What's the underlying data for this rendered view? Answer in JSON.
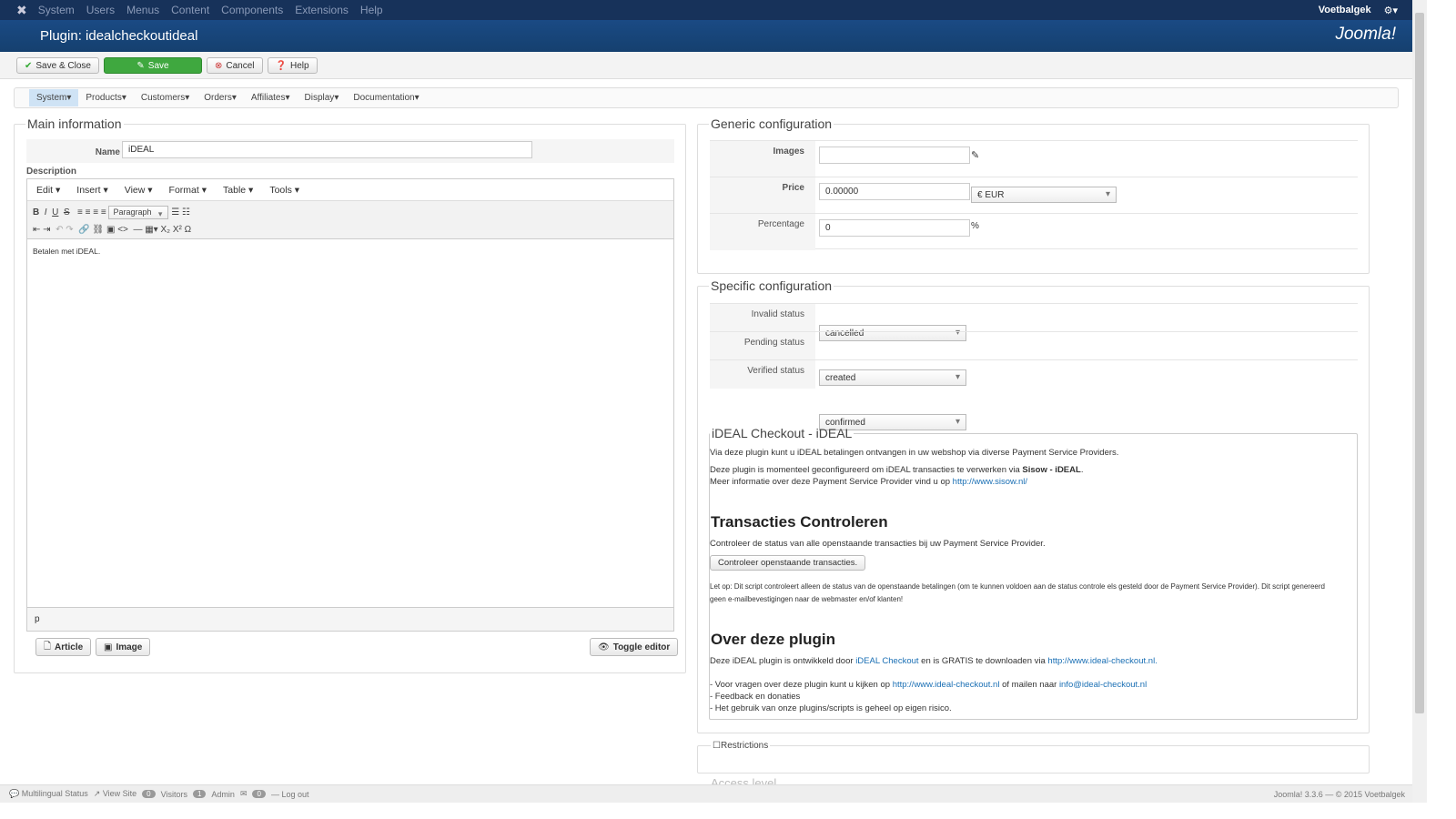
{
  "topnav": {
    "menus": [
      "System",
      "Users",
      "Menus",
      "Content",
      "Components",
      "Extensions",
      "Help"
    ],
    "user": "Voetbalgek"
  },
  "header": {
    "title": "Plugin: idealcheckoutideal",
    "brand": "Joomla!"
  },
  "toolbar": {
    "save_close": "Save & Close",
    "save": "Save",
    "cancel": "Cancel",
    "help": "Help"
  },
  "submenu": [
    "System",
    "Products",
    "Customers",
    "Orders",
    "Affiliates",
    "Display",
    "Documentation"
  ],
  "main": {
    "legend": "Main information",
    "name_label": "Name",
    "name_value": "iDEAL",
    "description_label": "Description",
    "editor_menu": [
      "Edit",
      "Insert",
      "View",
      "Format",
      "Table",
      "Tools"
    ],
    "format_select": "Paragraph",
    "content": "Betalen met iDEAL.",
    "path": "p",
    "article": "Article",
    "image": "Image",
    "toggle": "Toggle editor"
  },
  "generic": {
    "legend": "Generic configuration",
    "images_label": "Images",
    "price_label": "Price",
    "price_value": "0.00000",
    "currency": "€ EUR",
    "percentage_label": "Percentage",
    "percentage_value": "0",
    "percent_sign": "%"
  },
  "specific": {
    "legend": "Specific configuration",
    "rows": [
      {
        "label": "Invalid status",
        "value": "cancelled"
      },
      {
        "label": "Pending status",
        "value": "created"
      },
      {
        "label": "Verified status",
        "value": "confirmed"
      }
    ]
  },
  "ideal": {
    "legend": "iDEAL Checkout - iDEAL",
    "p1": "Via deze plugin kunt u iDEAL betalingen ontvangen in uw webshop via diverse Payment Service Providers.",
    "p2a": "Deze plugin is momenteel geconfigureerd om iDEAL transacties te verwerken via ",
    "p2b": "Sisow - iDEAL",
    "p3a": "Meer informatie over deze Payment Service Provider vind u op ",
    "p3link": "http://www.sisow.nl/",
    "h_trans": "Transacties Controleren",
    "p4": "Controleer de status van alle openstaande transacties bij uw Payment Service Provider.",
    "check_button": "Controleer openstaande transacties.",
    "note1": "Let op: Dit script controleert alleen de status van de openstaande betalingen (om te kunnen voldoen aan de status controle els gesteld door de Payment Service Provider). Dit script genereerd",
    "note2": "geen e-mailbevestigingen naar de webmaster en/of klanten!",
    "h_over": "Over deze plugin",
    "o1a": "Deze iDEAL plugin is ontwikkeld door ",
    "o1link": "iDEAL Checkout",
    "o1b": " en is GRATIS te downloaden via ",
    "o1url": "http://www.ideal-checkout.nl.",
    "o2a": "- Voor vragen over deze plugin kunt u kijken op ",
    "o2url": "http://www.ideal-checkout.nl",
    "o2b": " of mailen naar ",
    "o2mail": "info@ideal-checkout.nl",
    "o3": "- Feedback en donaties",
    "o4": "- Het gebruik van onze plugins/scripts is geheel op eigen risico."
  },
  "restrictions": "Restrictions",
  "access": "Access level",
  "footer": {
    "multilingual": "Multilingual Status",
    "view_site": "View Site",
    "visitors_count": "0",
    "visitors": "Visitors",
    "admin_count": "1",
    "admin": "Admin",
    "msg_count": "0",
    "logout": "Log out",
    "version": "Joomla! 3.3.6 — © 2015 Voetbalgek"
  }
}
